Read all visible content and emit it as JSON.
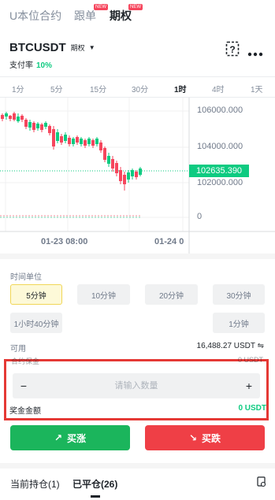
{
  "top_tabs": [
    {
      "label": "U本位合约",
      "active": false
    },
    {
      "label": "跟单",
      "active": false,
      "badge": "NEW"
    },
    {
      "label": "期权",
      "active": true,
      "badge": "NEW"
    }
  ],
  "symbol": {
    "name": "BTCUSDT",
    "tag": "期权"
  },
  "payout": {
    "label": "支付率",
    "value": "10%"
  },
  "timeframes": [
    "1分",
    "5分",
    "15分",
    "30分",
    "1时",
    "4时",
    "1天"
  ],
  "active_timeframe": "1时",
  "chart": {
    "price_ticks": [
      "106000.000",
      "104000.000",
      "102000.000",
      "0"
    ],
    "current_price": "102635.390",
    "time_labels": [
      "01-23 08:00",
      "01-24 0"
    ]
  },
  "order": {
    "time_unit_label": "时间单位",
    "units": [
      {
        "label": "5分钟",
        "active": true
      },
      {
        "label": "10分钟",
        "active": false
      },
      {
        "label": "20分钟",
        "active": false
      },
      {
        "label": "30分钟",
        "active": false
      },
      {
        "label": "1小时40分钟",
        "active": false
      },
      {
        "label": "1分钟",
        "active": false
      }
    ],
    "available_label": "可用",
    "available_value": "16,488.27 USDT",
    "hidden_row_label": "合约保金",
    "hidden_row_value": "0 USDT",
    "qty_placeholder": "请输入数量",
    "minus": "−",
    "plus": "+",
    "award_label": "奖金金额",
    "award_value": "0 USDT",
    "buy_up": "买涨",
    "buy_down": "买跌"
  },
  "bottom_tabs": [
    {
      "label": "当前持仓(1)",
      "active": false
    },
    {
      "label": "已平仓(26)",
      "active": true
    }
  ],
  "colors": {
    "up": "#0ecb81",
    "down": "#f6465d",
    "accent": "#f0b90b",
    "buy_up": "#1bb55c",
    "buy_down": "#ef3f46"
  }
}
